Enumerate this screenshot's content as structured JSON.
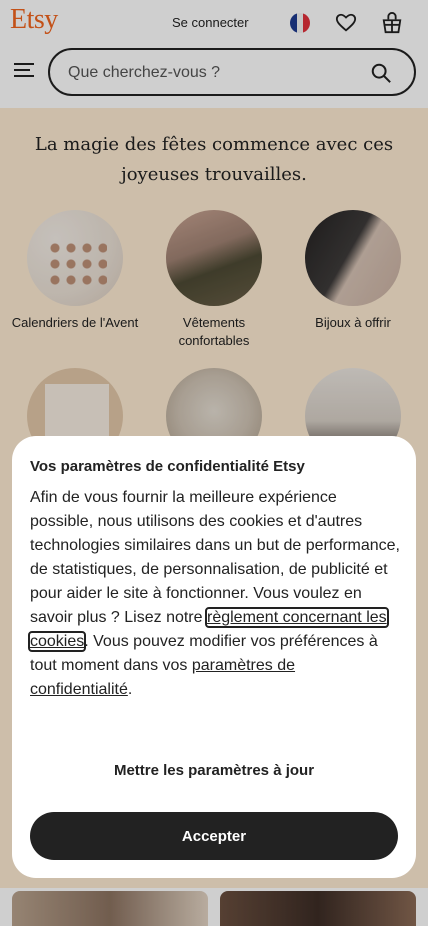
{
  "header": {
    "logo": "Etsy",
    "signin_label": "Se connecter",
    "country_flag": "france-flag",
    "icons": [
      "heart-icon",
      "basket-icon",
      "menu-icon",
      "search-icon"
    ],
    "brand_color": "#f1641e"
  },
  "search": {
    "placeholder": "Que cherchez-vous ?",
    "value": ""
  },
  "hero": {
    "title": "La magie des fêtes commence avec ces joyeuses trouvailles.",
    "background_color": "#fdebd2",
    "categories": [
      {
        "label": "Calendriers de l'Avent"
      },
      {
        "label": "Vêtements confortables"
      },
      {
        "label": "Bijoux à offrir"
      },
      {
        "label": ""
      },
      {
        "label": ""
      },
      {
        "label": ""
      }
    ]
  },
  "modal": {
    "title": "Vos paramètres de confidentialité Etsy",
    "body_part1": "Afin de vous fournir la meilleure expérience possible, nous utilisons des cookies et d'autres technologies similaires dans un but de performance, de statistiques, de personnalisation, de publicité et pour aider le site à fonctionner. Vous voulez en savoir plus ? Lisez notre ",
    "cookie_policy_link": "règlement concernant les cookies",
    "body_part2": ". Vous pouvez modifier vos préférences à tout moment dans vos ",
    "privacy_settings_link": "paramètres de confidentialité",
    "body_part3": ".",
    "update_button": "Mettre les paramètres à jour",
    "accept_button": "Accepter"
  }
}
